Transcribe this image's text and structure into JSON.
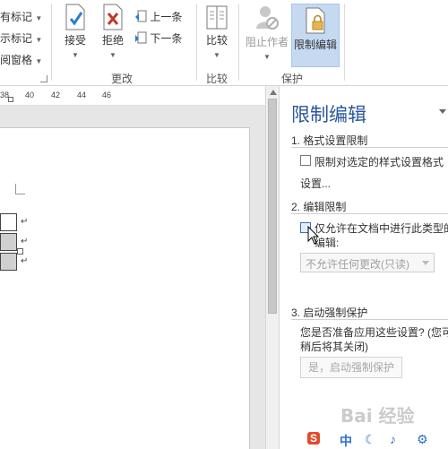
{
  "ribbon": {
    "markup_items": [
      "有标记",
      "示标记",
      "阅窗格"
    ],
    "accept_label": "接受",
    "reject_label": "拒绝",
    "prev_label": "上一条",
    "next_label": "下一条",
    "compare_label": "比较",
    "block_authors_label": "阻止作者",
    "restrict_editing_label": "限制编辑",
    "groups": {
      "changes": "更改",
      "compare": "比较",
      "protect": "保护"
    }
  },
  "ruler": {
    "labels": [
      "38",
      "40",
      "42",
      "44",
      "46"
    ]
  },
  "document": {
    "paragraph_mark": "↵"
  },
  "pane": {
    "title": "限制编辑",
    "section1_heading": "1. 格式设置限制",
    "format_checkbox_label": "限制对选定的样式设置格式",
    "settings_link": "设置...",
    "section2_heading": "2. 编辑限制",
    "edit_checkbox_label": "仅允许在文档中进行此类型的",
    "edit_checkbox_label_cont": "编辑:",
    "edit_type_select": "不允许任何更改(只读)",
    "section3_heading": "3. 启动强制保护",
    "prompt_line1": "您是否准备应用这些设置? (您可",
    "prompt_line2": "稍后将其关闭)",
    "enforce_button": "是，启动强制保护"
  },
  "watermark": "Bai 经验",
  "tray": [
    "S",
    "中",
    "♪",
    "⚙"
  ],
  "colors": {
    "accent": "#2b579a",
    "selected_bg": "#c5daf1",
    "reject_red": "#c0392b"
  }
}
